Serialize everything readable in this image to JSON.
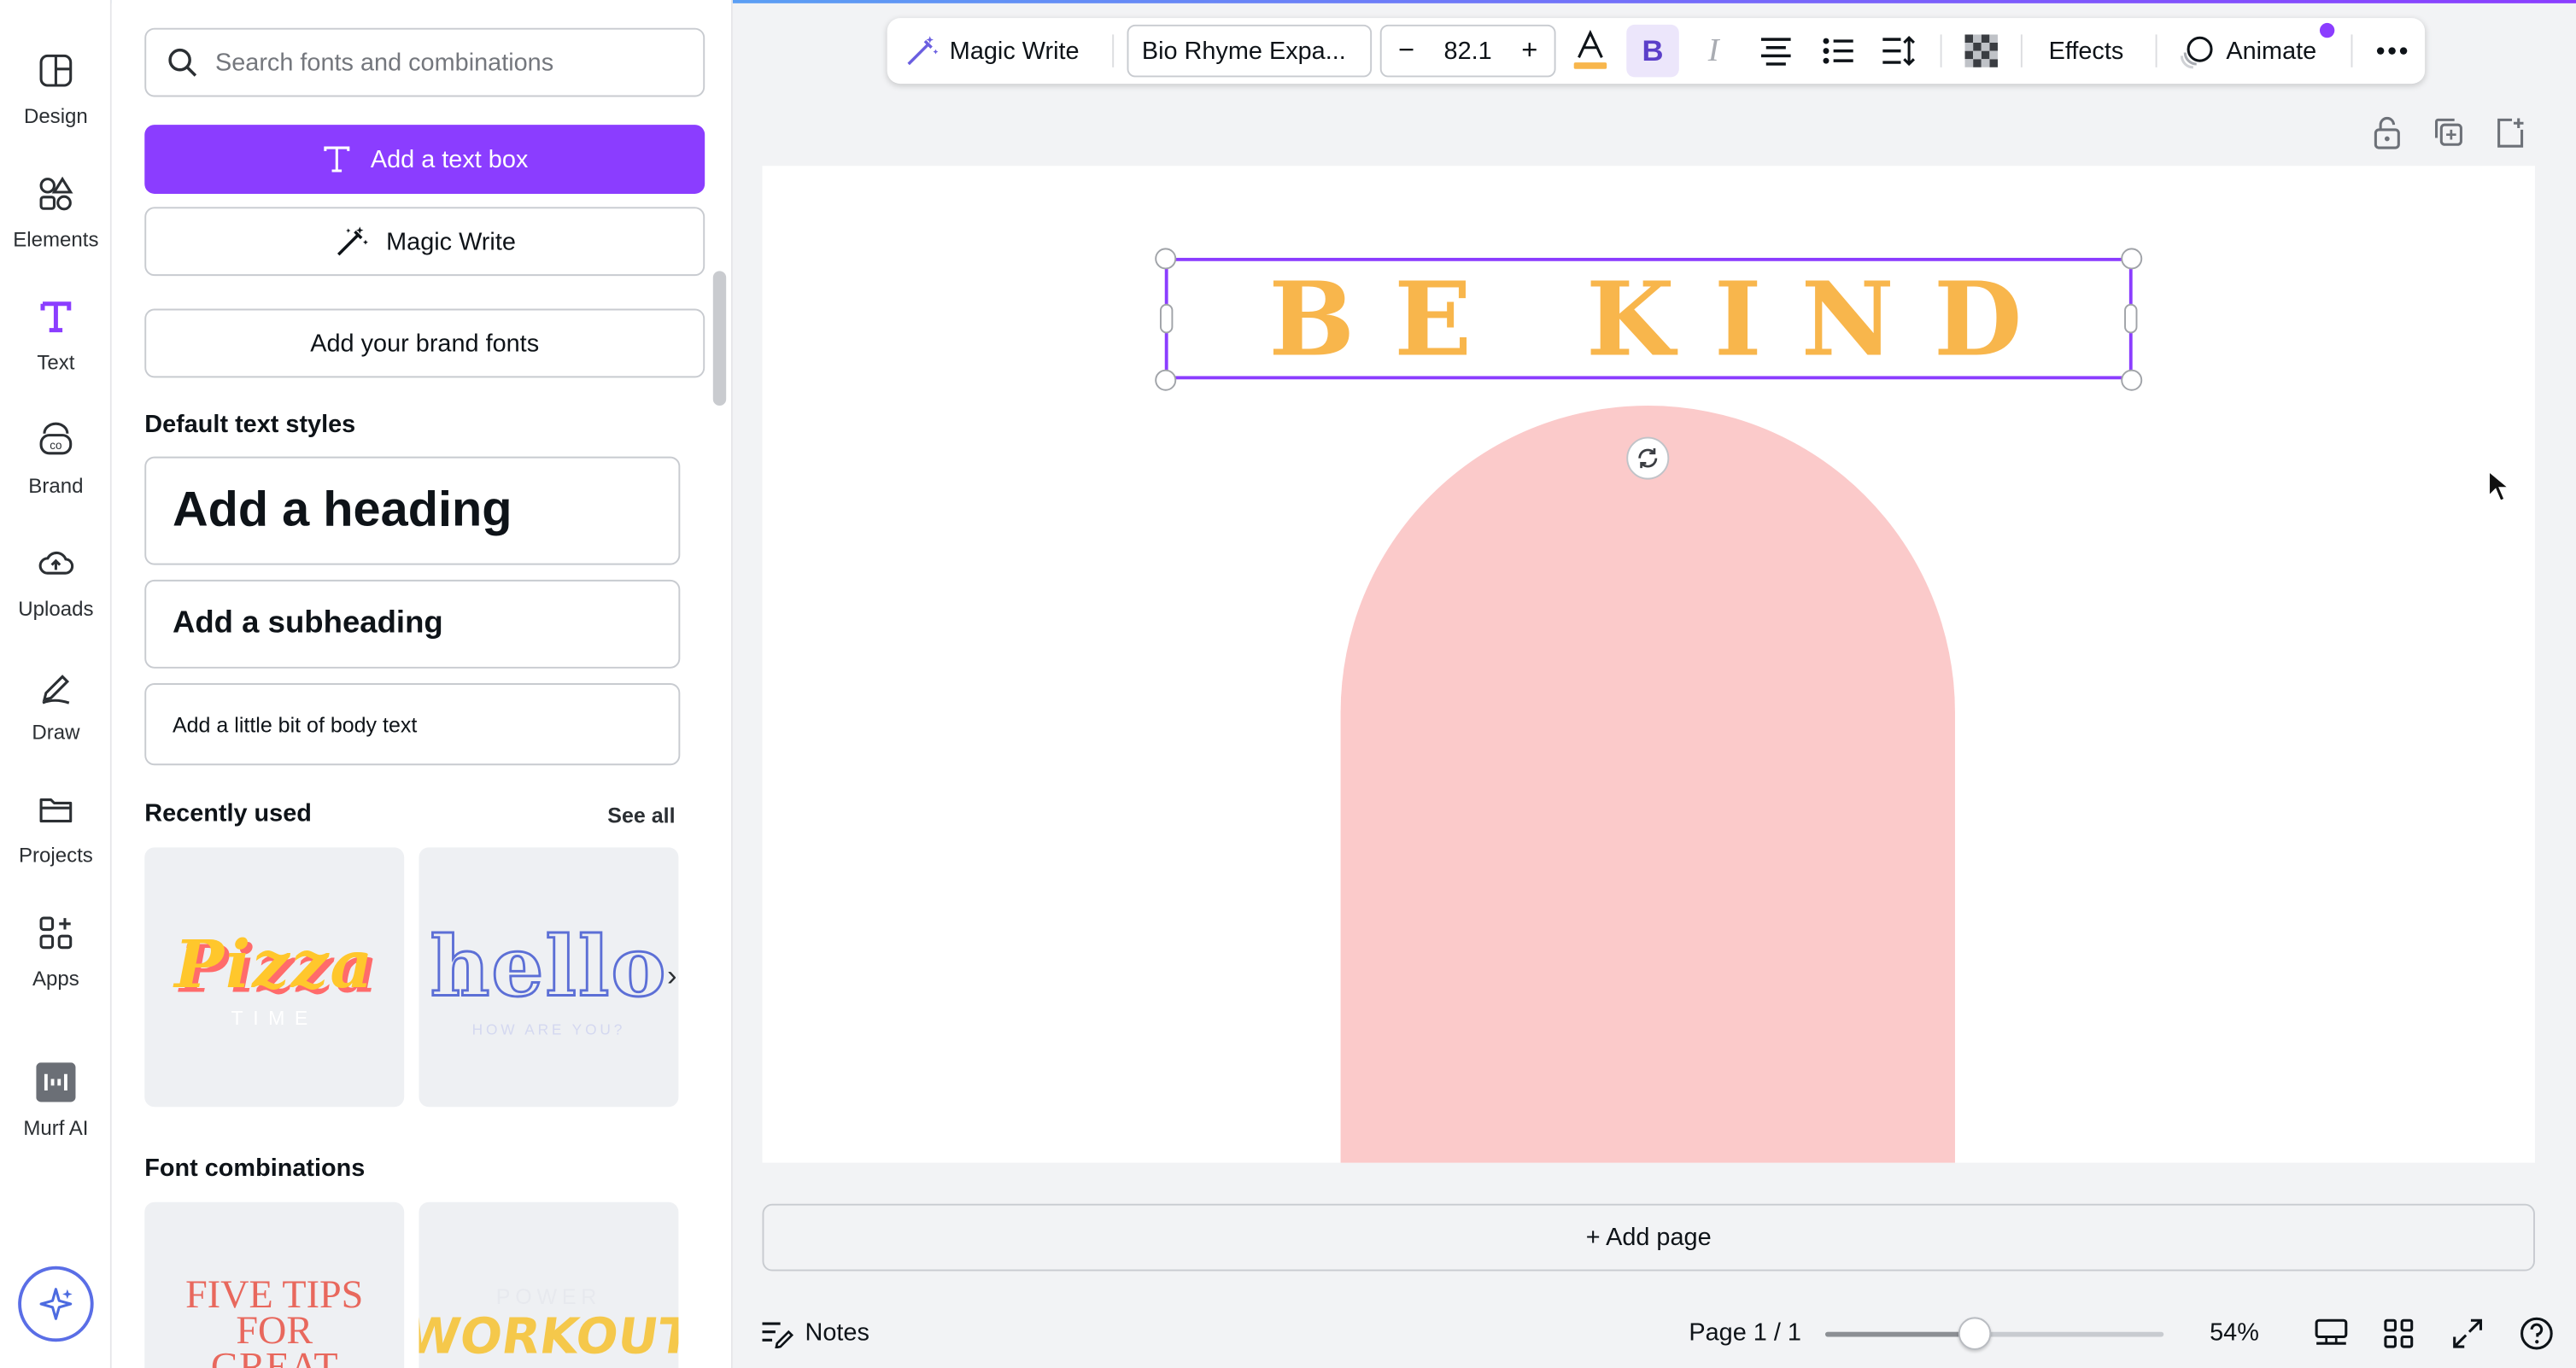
{
  "rail": {
    "items": [
      {
        "label": "Design",
        "icon": "design-icon"
      },
      {
        "label": "Elements",
        "icon": "elements-icon"
      },
      {
        "label": "Text",
        "icon": "text-icon"
      },
      {
        "label": "Brand",
        "icon": "brand-icon"
      },
      {
        "label": "Uploads",
        "icon": "upload-cloud-icon"
      },
      {
        "label": "Draw",
        "icon": "pen-icon"
      },
      {
        "label": "Projects",
        "icon": "folder-icon"
      },
      {
        "label": "Apps",
        "icon": "apps-grid-icon"
      },
      {
        "label": "Murf AI",
        "icon": "murf-ai-icon"
      }
    ],
    "active": "Text"
  },
  "panel": {
    "search_placeholder": "Search fonts and combinations",
    "add_text_box": "Add a text box",
    "magic_write": "Magic Write",
    "add_brand_fonts": "Add your brand fonts",
    "default_styles_title": "Default text styles",
    "heading": "Add a heading",
    "subheading": "Add a subheading",
    "body": "Add a little bit of body text",
    "recently_used_title": "Recently used",
    "see_all": "See all",
    "recent": [
      {
        "main": "Pizza",
        "sub": "TIME"
      },
      {
        "main": "hello",
        "sub": "HOW ARE YOU?"
      }
    ],
    "font_combinations_title": "Font combinations",
    "combos": [
      {
        "main": "FIVE TIPS FOR GREAT SKIN"
      },
      {
        "main": "WORKOUT",
        "sub": "POWER"
      }
    ]
  },
  "toolbar": {
    "magic_write": "Magic Write",
    "font_name": "Bio Rhyme Expa...",
    "font_size": "82.1",
    "minus": "−",
    "plus": "+",
    "effects": "Effects",
    "animate": "Animate",
    "text_color": "#f8b64c",
    "accent": "#8b3dff"
  },
  "canvas": {
    "headline": "BE KIND",
    "headline_color": "#f8b64c",
    "arch_color": "#fbcaca"
  },
  "add_page": "+ Add page",
  "bottom": {
    "notes": "Notes",
    "page_indicator": "Page 1 / 1",
    "zoom": "54%",
    "zoom_fraction": 0.44
  }
}
